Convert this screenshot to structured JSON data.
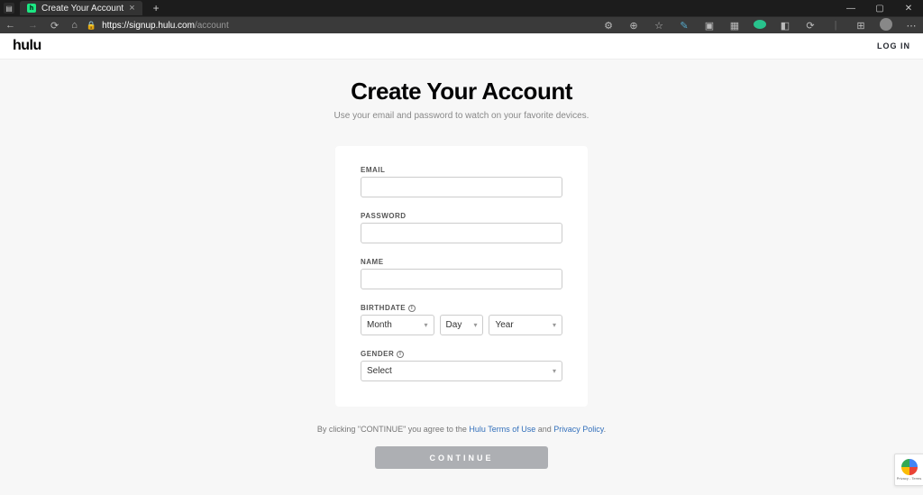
{
  "browser": {
    "tab_title": "Create Your Account",
    "url_host": "https://signup.hulu.com",
    "url_path": "/account"
  },
  "topbar": {
    "logo_text": "hulu",
    "login_label": "LOG IN"
  },
  "header": {
    "title": "Create Your Account",
    "subtitle": "Use your email and password to watch on your favorite devices."
  },
  "form": {
    "email_label": "EMAIL",
    "password_label": "PASSWORD",
    "name_label": "NAME",
    "birthdate_label": "BIRTHDATE",
    "birthdate": {
      "month": "Month",
      "day": "Day",
      "year": "Year"
    },
    "gender_label": "GENDER",
    "gender_value": "Select"
  },
  "legal": {
    "prefix": "By clicking \"CONTINUE\" you agree to the ",
    "link1": "Hulu Terms of Use",
    "and": " and ",
    "link2": "Privacy Policy",
    "suffix": "."
  },
  "cta_label": "CONTINUE",
  "recaptcha": {
    "line1": "Privacy - Terms"
  }
}
